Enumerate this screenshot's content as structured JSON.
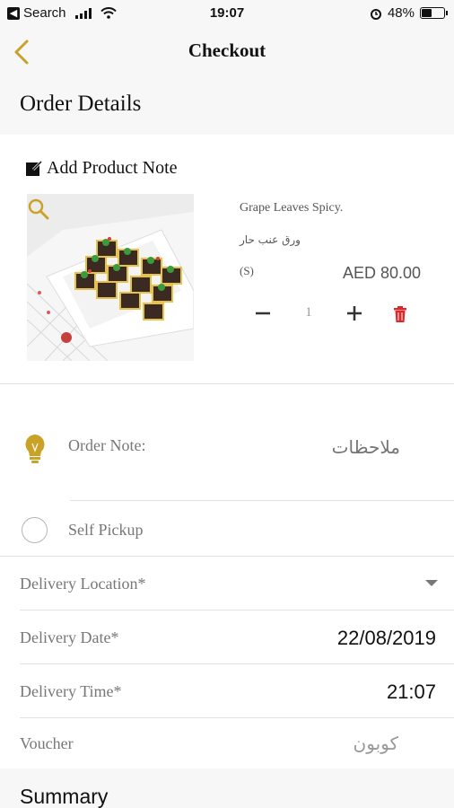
{
  "status_bar": {
    "back_app": "Search",
    "time": "19:07",
    "battery_text": "48%",
    "battery_level": 0.48
  },
  "nav": {
    "title": "Checkout"
  },
  "order_details": {
    "heading": "Order Details",
    "add_note_label": "Add Product Note",
    "product": {
      "name": "Grape Leaves Spicy.",
      "name_ar": "ورق عنب حار",
      "size": "(S)",
      "price": "AED 80.00",
      "quantity": "1"
    }
  },
  "order_note": {
    "label": "Order Note:",
    "placeholder": "ملاحظات"
  },
  "self_pickup": {
    "label": "Self Pickup",
    "checked": false
  },
  "delivery": {
    "location_label": "Delivery Location*",
    "date_label": "Delivery Date*",
    "date_value": "22/08/2019",
    "time_label": "Delivery Time*",
    "time_value": "21:07"
  },
  "voucher": {
    "label": "Voucher",
    "placeholder": "كوبون"
  },
  "summary": {
    "heading": "Summary"
  },
  "colors": {
    "accent": "#c9a227",
    "delete": "#e0262a",
    "section_bg": "#f7f7f7"
  }
}
